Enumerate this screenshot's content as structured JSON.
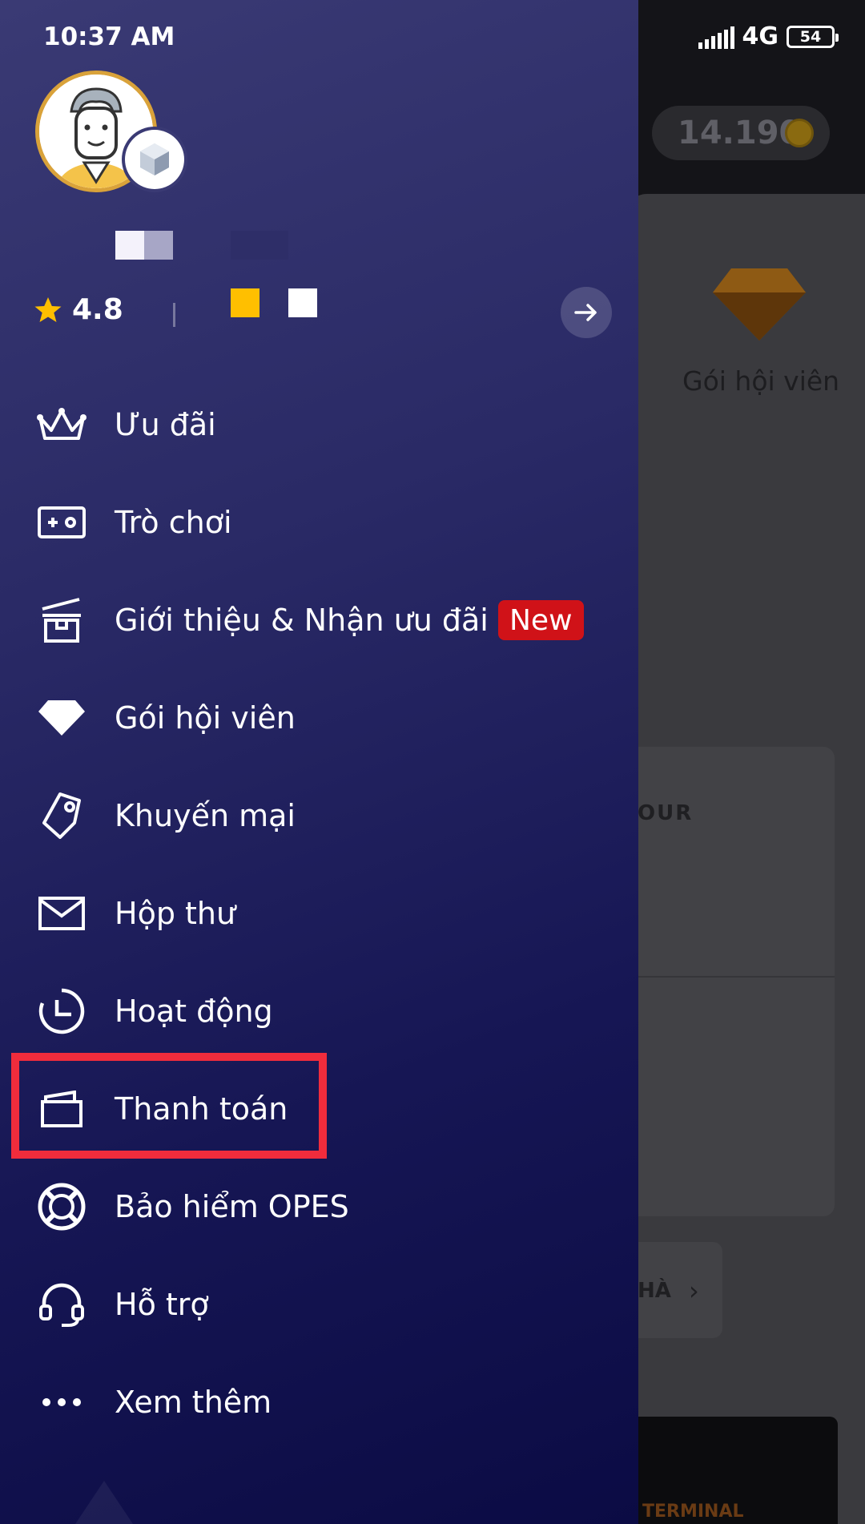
{
  "status_bar": {
    "time": "10:37 AM",
    "network": "4G",
    "battery": "54"
  },
  "profile": {
    "rating": "4.8"
  },
  "background": {
    "coin_balance": "14.190",
    "member_card_label": "Gói hội viên",
    "tour_text": "OUR",
    "ha_text": "HÀ",
    "terminal_text": "TERMINAL"
  },
  "menu": [
    {
      "label": "Ưu đãi",
      "icon": "crown-icon"
    },
    {
      "label": "Trò chơi",
      "icon": "game-ticket-icon"
    },
    {
      "label": "Giới thiệu & Nhận ưu đãi",
      "icon": "gift-icon",
      "badge": "New"
    },
    {
      "label": "Gói hội viên",
      "icon": "diamond-icon"
    },
    {
      "label": "Khuyến mại",
      "icon": "tag-icon"
    },
    {
      "label": "Hộp thư",
      "icon": "mail-icon"
    },
    {
      "label": "Hoạt động",
      "icon": "clock-icon"
    },
    {
      "label": "Thanh toán",
      "icon": "wallet-icon",
      "highlighted": true
    },
    {
      "label": "Bảo hiểm OPES",
      "icon": "lifebuoy-icon"
    },
    {
      "label": "Hỗ trợ",
      "icon": "headset-icon"
    },
    {
      "label": "Xem thêm",
      "icon": "more-dots-icon"
    }
  ],
  "colors": {
    "highlight": "#f02c3c",
    "badge": "#d01218",
    "star": "#ffbf00",
    "avatar_ring": "#d9a23a"
  }
}
